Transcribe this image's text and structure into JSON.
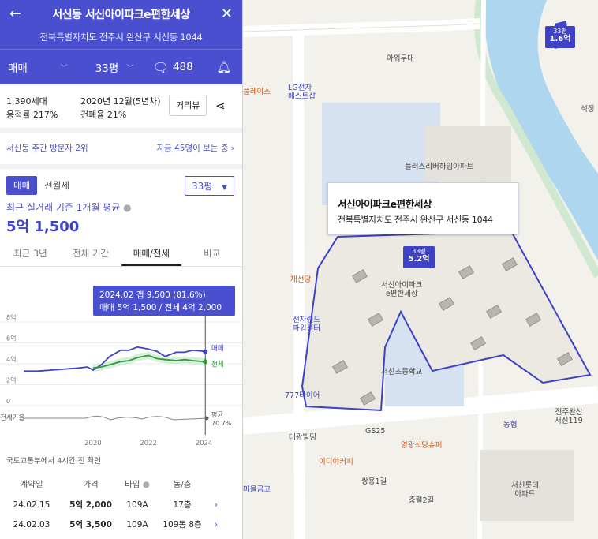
{
  "header": {
    "title": "서신동 서신아이파크e편한세상",
    "address": "전북특별자치도 전주시 완산구 서신동 1044",
    "tabs": {
      "trade": "매매",
      "size": "33평",
      "comments": "488"
    }
  },
  "summary": {
    "households": "1,390세대",
    "floor_area_ratio": "용적률 217%",
    "built": "2020년 12월(5년차)",
    "coverage_ratio": "건폐율 21%",
    "street_view_label": "거리뷰"
  },
  "rank": {
    "left": "서신동 주간 방문자 2위",
    "right": "지금 45명이 보는 중 ›"
  },
  "price": {
    "seg_on": "매매",
    "seg_off": "전월세",
    "area_select": "33평",
    "avg_label": "최근 실거래 기준 1개월 평균",
    "avg_value": "5억 1,500",
    "tabs": [
      "최근 3년",
      "전체 기간",
      "매매/전세",
      "비교"
    ]
  },
  "chart_data": {
    "type": "line",
    "x": [
      2017.5,
      2018.0,
      2018.5,
      2019.0,
      2019.5,
      2019.8,
      2020.0,
      2020.3,
      2020.6,
      2021.0,
      2021.3,
      2021.6,
      2022.0,
      2022.3,
      2022.6,
      2023.0,
      2023.3,
      2023.6,
      2024.0,
      2024.1
    ],
    "series": [
      {
        "name": "매매",
        "values": [
          3.3,
          3.3,
          3.4,
          3.5,
          3.6,
          3.7,
          3.4,
          3.9,
          4.7,
          5.3,
          5.3,
          5.6,
          5.4,
          5.2,
          4.7,
          5.1,
          5.1,
          5.3,
          5.2,
          5.15
        ]
      },
      {
        "name": "전세",
        "values": [
          null,
          null,
          null,
          null,
          null,
          null,
          3.6,
          3.7,
          3.9,
          4.2,
          4.3,
          4.6,
          4.8,
          4.5,
          4.4,
          4.3,
          4.4,
          4.3,
          4.2,
          4.2
        ]
      }
    ],
    "ratio_label": "전세가율",
    "ratio_name": "평균",
    "ratio_value": "70.7%",
    "y_ticks": [
      "8억",
      "6억",
      "4억",
      "2억",
      "0"
    ],
    "x_ticks": [
      "2020",
      "2022",
      "2024"
    ],
    "ylim": [
      0,
      8
    ],
    "tooltip": {
      "line1": "2024.02  갭 9,500 (81.6%)",
      "line2": "매매 5억 1,500 / 전세 4억 2,000"
    },
    "colors": {
      "sale": "#3d42c6",
      "jeonse": "#2f9a3e",
      "band": "#c8cbe8"
    }
  },
  "source_note": "국토교통부에서 4시간 전 확인",
  "table": {
    "headers": [
      "계약일",
      "가격",
      "타입",
      "동/층"
    ],
    "rows": [
      {
        "date": "24.02.15",
        "price": "5억 2,000",
        "type": "109A",
        "floor": "17층"
      },
      {
        "date": "24.02.03",
        "price": "5억 3,500",
        "type": "109A",
        "floor": "109동 8층"
      }
    ]
  },
  "map": {
    "popup_title": "서신아이파크e편한세상",
    "popup_address": "전북특별자치도 전주시 완산구 서신동 1044",
    "marker_main": {
      "top": "33평",
      "price": "5.2억"
    },
    "marker_other": {
      "top": "33평",
      "price": "1.6억"
    },
    "labels": {
      "venue": "아워무대",
      "lg": "LG전자\n베스트샵",
      "flower": "플러스리버하임아파트",
      "chaeseon": "채선당",
      "complex": "서신아이파크\ne편한세상",
      "school": "서신초등학교",
      "tire": "777타이어",
      "electronics": "전자랜드\n파워센터",
      "gs25": "GS25",
      "daegwang": "대광빌딩",
      "yeonggwang": "영광식당슈퍼",
      "idiya": "이디야커피",
      "nonghyup": "농협",
      "lotte": "서신롯데\n아파트",
      "seoknam": "석정",
      "bank": "마을금고",
      "jeonju": "전주완산\n서신119",
      "road1": "쌍용1길",
      "road2": "충렬2길",
      "plaza": "플레이스"
    }
  }
}
